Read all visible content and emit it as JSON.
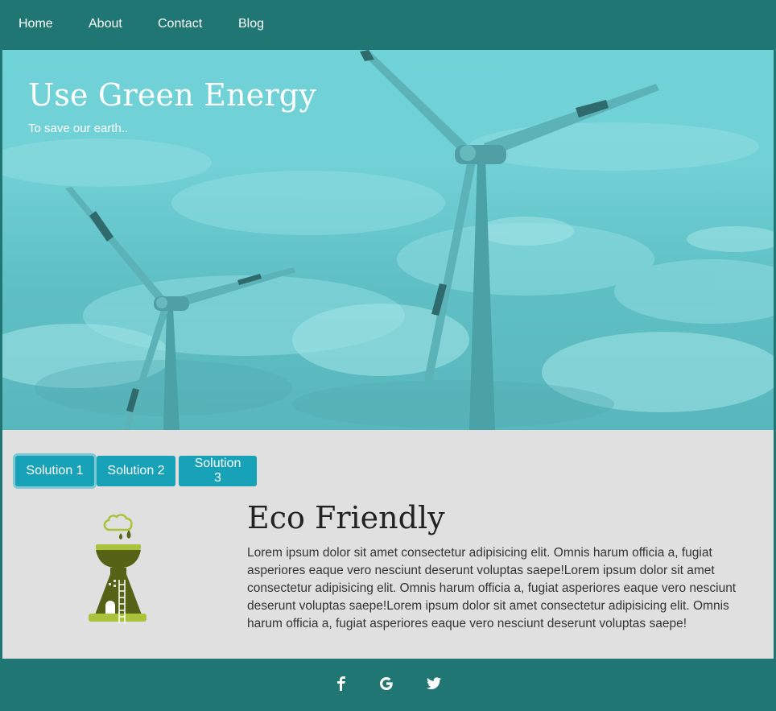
{
  "nav": {
    "items": [
      {
        "label": "Home"
      },
      {
        "label": "About"
      },
      {
        "label": "Contact"
      },
      {
        "label": "Blog"
      }
    ]
  },
  "hero": {
    "title": "Use Green Energy",
    "subtitle": "To save our earth.."
  },
  "tabs": [
    {
      "label": "Solution 1",
      "active": true
    },
    {
      "label": "Solution 2",
      "active": false
    },
    {
      "label": "Solution 3",
      "active": false
    }
  ],
  "section": {
    "title": "Eco Friendly",
    "body": "Lorem ipsum dolor sit amet consectetur adipisicing elit. Omnis harum officia a, fugiat asperiores eaque vero nesciunt deserunt voluptas saepe!Lorem ipsum dolor sit amet consectetur adipisicing elit. Omnis harum officia a, fugiat asperiores eaque vero nesciunt deserunt voluptas saepe!Lorem ipsum dolor sit amet consectetur adipisicing elit. Omnis harum officia a, fugiat asperiores eaque vero nesciunt deserunt voluptas saepe!"
  },
  "footer": {
    "social": [
      {
        "icon": "facebook-icon"
      },
      {
        "icon": "google-icon"
      },
      {
        "icon": "twitter-icon"
      }
    ]
  },
  "colors": {
    "primary": "#1f7673",
    "tab": "#17a2b8",
    "content_bg": "#e0e0e0",
    "icon_olive": "#566216",
    "icon_lime": "#a9c33c"
  }
}
